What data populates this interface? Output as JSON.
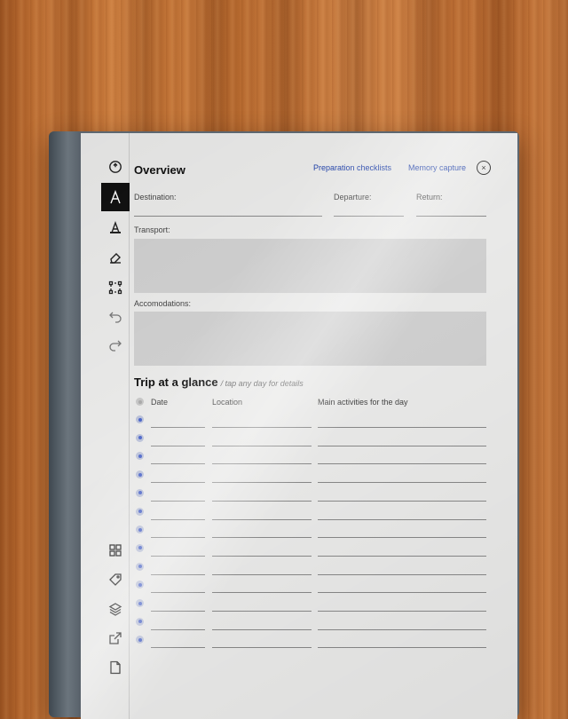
{
  "toolbar": {
    "top_tools": [
      {
        "name": "menu-icon"
      },
      {
        "name": "writing-tool-icon",
        "active": true
      },
      {
        "name": "highlighter-icon"
      },
      {
        "name": "eraser-icon"
      },
      {
        "name": "selection-icon"
      },
      {
        "name": "undo-icon"
      },
      {
        "name": "redo-icon"
      }
    ],
    "bottom_tools": [
      {
        "name": "pages-grid-icon"
      },
      {
        "name": "tag-icon"
      },
      {
        "name": "layers-icon"
      },
      {
        "name": "share-icon"
      },
      {
        "name": "document-icon"
      }
    ]
  },
  "page": {
    "title": "Overview",
    "links": {
      "preparation": "Preparation checklists",
      "memory": "Memory capture"
    },
    "close_symbol": "×",
    "fields": {
      "destination": "Destination:",
      "departure": "Departure:",
      "return": "Return:",
      "transport": "Transport:",
      "accommodations": "Accomodations:"
    },
    "trip": {
      "title": "Trip at a glance",
      "hint": "/ tap any day for details",
      "columns": {
        "date": "Date",
        "location": "Location",
        "activities": "Main activities for the day"
      },
      "row_count": 13
    }
  },
  "colors": {
    "accent": "#1c3ea8",
    "dot": "#4a64c8",
    "screen": "#e9e9e8"
  }
}
